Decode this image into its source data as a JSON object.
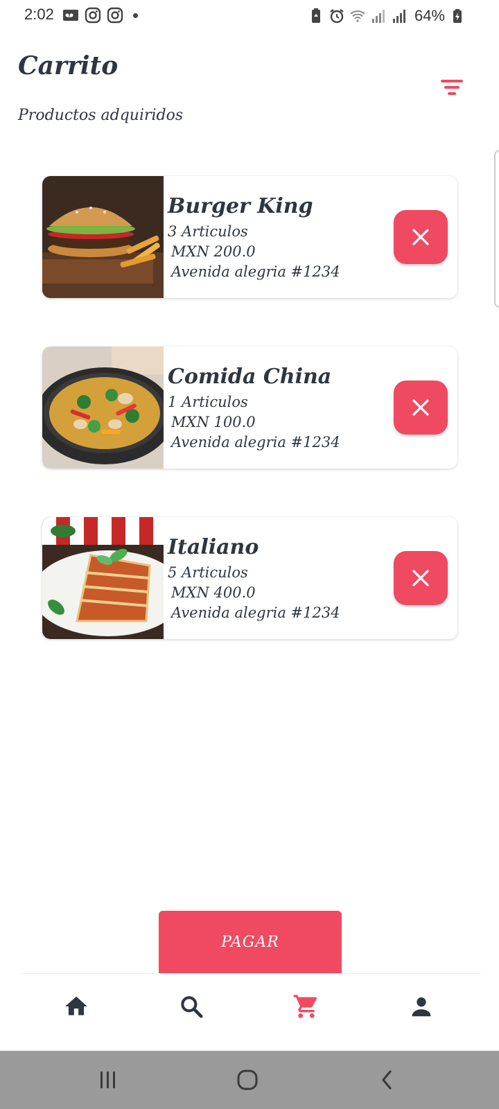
{
  "status_bar": {
    "time": "2:02",
    "battery": "64%",
    "left_icons": [
      "voicemail-icon",
      "instagram-icon",
      "instagram-icon",
      "notification-dot-icon"
    ],
    "right_icons": [
      "battery-saver-icon",
      "alarm-icon",
      "wifi-icon",
      "signal-icon",
      "signal-icon",
      "battery-charging-icon"
    ]
  },
  "header": {
    "title": "Carrito",
    "subtitle": "Productos adquiridos",
    "filter_icon": "filter-list-icon"
  },
  "cart_items": [
    {
      "name": "Burger King",
      "quantity": "3 Articulos",
      "price": "MXN 200.0",
      "address": "Avenida alegria #1234",
      "image": "burger-photo"
    },
    {
      "name": "Comida China",
      "quantity": "1 Articulos",
      "price": "MXN 100.0",
      "address": "Avenida alegria #1234",
      "image": "stir-fry-photo"
    },
    {
      "name": "Italiano",
      "quantity": "5 Articulos",
      "price": "MXN 400.0",
      "address": "Avenida alegria #1234",
      "image": "lasagna-photo"
    }
  ],
  "pay_button": {
    "label": "PAGAR"
  },
  "bottom_nav": {
    "items": [
      {
        "icon": "home-icon",
        "active": false
      },
      {
        "icon": "search-icon",
        "active": false
      },
      {
        "icon": "cart-icon",
        "active": true
      },
      {
        "icon": "person-icon",
        "active": false
      }
    ]
  },
  "system_nav": [
    "recents-icon",
    "home-circle-icon",
    "back-icon"
  ],
  "colors": {
    "accent": "#ef4a62",
    "text": "#2f3640",
    "system_nav_bg": "#9a9a9a"
  }
}
